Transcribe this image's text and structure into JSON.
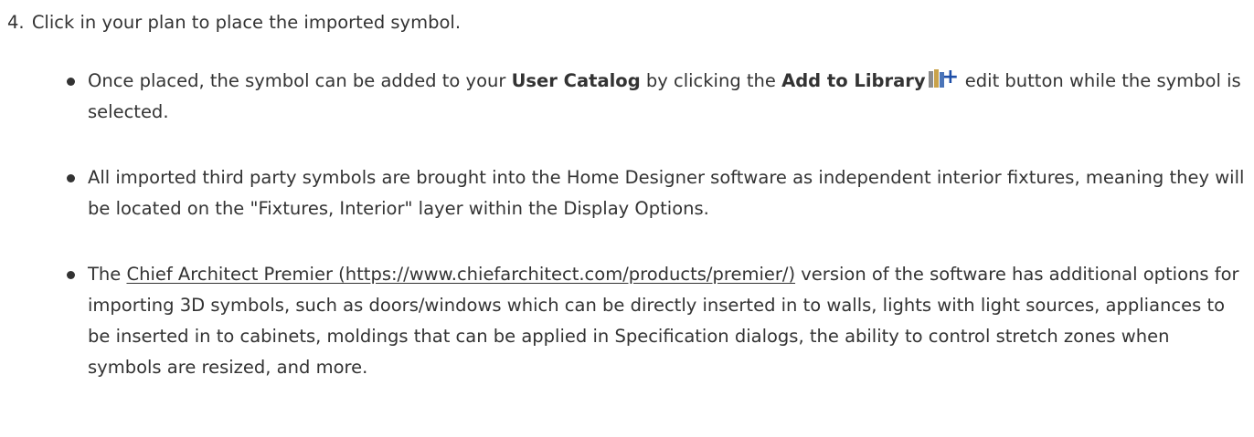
{
  "step": {
    "number": "4.",
    "text": "Click in your plan to place the imported symbol."
  },
  "bullets": [
    {
      "pre": "Once placed, the symbol can be added to your ",
      "bold1": "User Catalog",
      "mid": " by clicking the ",
      "bold2": "Add to Library",
      "icon": "add-to-library-icon",
      "post": " edit button while the symbol is selected."
    },
    {
      "text": "All imported third party symbols are brought into the Home Designer software as independent interior fixtures, meaning they will be located on the \"Fixtures, Interior\" layer within the Display Options."
    },
    {
      "pre": "The ",
      "link": "Chief Architect Premier (https://www.chiefarchitect.com/products/premier/)",
      "post": " version of the software has additional options for importing 3D symbols, such as doors/windows which can be directly inserted in to walls, lights with light sources, appliances to be inserted in to cabinets, moldings that can be applied in Specification dialogs, the ability to control stretch zones when symbols are resized, and more."
    }
  ]
}
